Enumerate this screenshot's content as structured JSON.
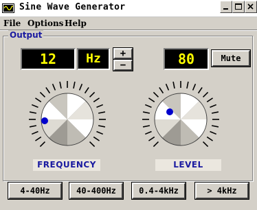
{
  "window": {
    "title": "Sine Wave Generator"
  },
  "menu": {
    "items": [
      "File",
      "Options",
      "Help"
    ]
  },
  "output_group": {
    "label": "Output"
  },
  "frequency": {
    "display_value": "12",
    "unit": "Hz",
    "increase_symbol": "+",
    "decrease_symbol": "−",
    "knob_label": "FREQUENCY"
  },
  "level": {
    "display_value": "80",
    "mute_label": "Mute",
    "knob_label": "LEVEL"
  },
  "range_buttons": [
    "4-40Hz",
    "40-400Hz",
    "0.4-4kHz",
    "> 4kHz"
  ],
  "colors": {
    "lcd_text": "#ffff00",
    "lcd_background": "#000000",
    "label_text": "#1a1aa0",
    "knob_marker": "#0000cc"
  }
}
